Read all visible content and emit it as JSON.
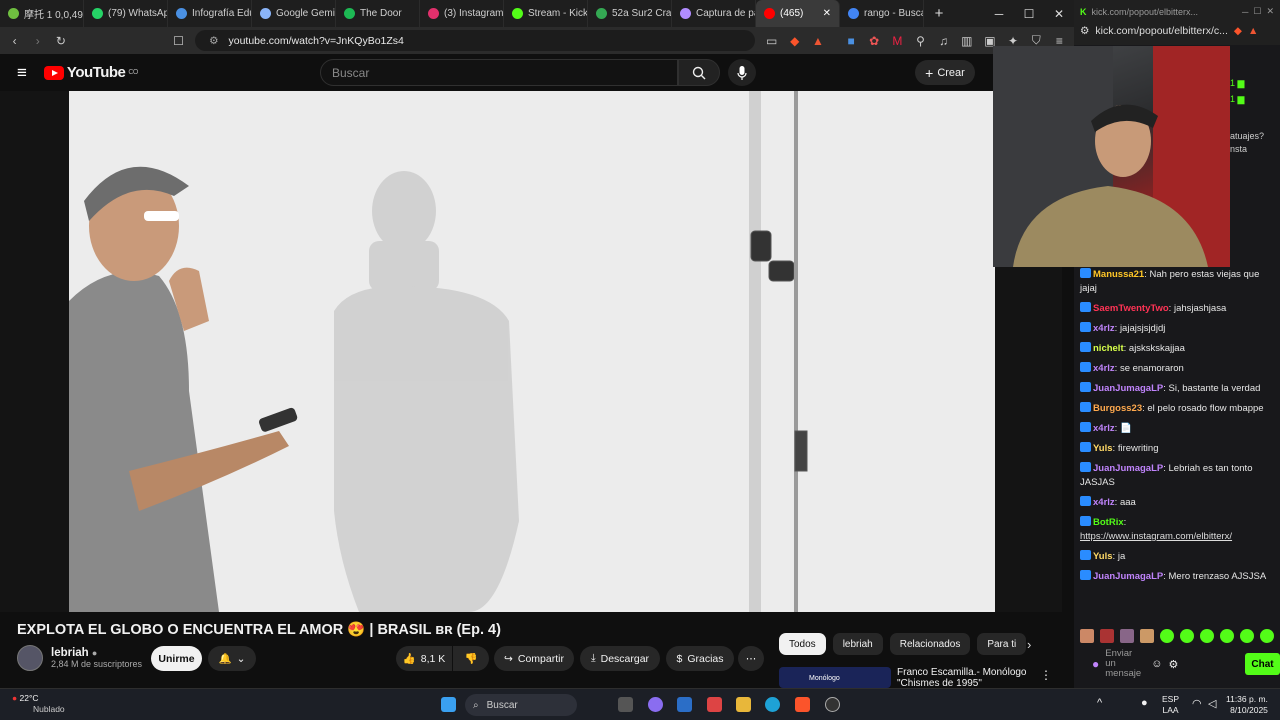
{
  "browser": {
    "tabs": [
      {
        "label": "摩托 1 0,0,494",
        "color": "#6fbf40"
      },
      {
        "label": "(79) WhatsApp",
        "color": "#25d366"
      },
      {
        "label": "Infografía Edu",
        "color": "#4a90e2"
      },
      {
        "label": "Google Gemin",
        "color": "#8ab4f8"
      },
      {
        "label": "The Door",
        "color": "#1db954"
      },
      {
        "label": "(3) Instagram",
        "color": "#e1306c"
      },
      {
        "label": "Stream - Kick",
        "color": "#53fc18"
      },
      {
        "label": "52a Sur2 Cra",
        "color": "#34a853"
      },
      {
        "label": "Captura de pa",
        "color": "#b18cff"
      },
      {
        "label": "(465)",
        "color": "#ff0000",
        "active": true
      },
      {
        "label": "rango - Busca",
        "color": "#4285f4"
      }
    ],
    "new_tab": "+",
    "url": "youtube.com/watch?v=JnKQyBo1Zs4"
  },
  "youtube": {
    "logo_text": "YouTube",
    "country": "CO",
    "search_placeholder": "Buscar",
    "create_label": "Crear",
    "video_title": "EXPLOTA EL GLOBO O ENCUENTRA EL AMOR 😍 | BRASIL ʙʀ (Ep. 4)",
    "channel_name": "lebriah",
    "subscribers": "2,84 M de suscriptores",
    "join_label": "Unirme",
    "likes": "8,1 K",
    "share_label": "Compartir",
    "download_label": "Descargar",
    "thanks_label": "Gracias",
    "more_label": "⋯",
    "chips": [
      "Todos",
      "lebriah",
      "Relacionados",
      "Para ti"
    ],
    "rec_title": "Franco Escamilla.- Monólogo",
    "rec_subtitle": "\"Chismes de 1995\"",
    "rec_thumb_text": "Monólogo"
  },
  "kick": {
    "url_dim": "kick.com/popout/elbitterx...",
    "url": "kick.com/popout/elbitterx/c...",
    "side_text_1": "atuajes?",
    "side_text_2": "nsta",
    "messages": [
      {
        "user": "Manussa21",
        "color": "#ffc627",
        "text": "Nah pero estas viejas que jajaj"
      },
      {
        "user": "SaemTwentyTwo",
        "color": "#ff3355",
        "text": "jahsjashjasa"
      },
      {
        "user": "x4rlz",
        "color": "#c084fc",
        "text": "jajajsjsjdjdj"
      },
      {
        "user": "nichelt",
        "color": "#d7ff4a",
        "text": "ajskskskajjaa"
      },
      {
        "user": "x4rlz",
        "color": "#c084fc",
        "text": "se enamoraron"
      },
      {
        "user": "JuanJumagaLP",
        "color": "#c084fc",
        "text": "Si, bastante la verdad"
      },
      {
        "user": "Burgoss23",
        "color": "#ffa94d",
        "text": "el pelo rosado flow mbappe"
      },
      {
        "user": "x4rlz",
        "color": "#c084fc",
        "text": "📄"
      },
      {
        "user": "Yuls",
        "color": "#ffd966",
        "text": "firewriting"
      },
      {
        "user": "JuanJumagaLP",
        "color": "#c084fc",
        "text": "Lebriah es tan tonto JASJAS"
      },
      {
        "user": "x4rlz",
        "color": "#c084fc",
        "text": "aaa"
      },
      {
        "user": "BotRix",
        "color": "#53fc18",
        "text": "https://www.instagram.com/elbitterx/"
      },
      {
        "user": "Yuls",
        "color": "#ffd966",
        "text": "ja"
      },
      {
        "user": "JuanJumagaLP",
        "color": "#c084fc",
        "text": "Mero trenzaso AJSJSA"
      }
    ],
    "input_placeholder": "Enviar un mensaje",
    "chat_button": "Chat"
  },
  "taskbar": {
    "weather_temp": "22°C",
    "weather_desc": "Nublado",
    "search_label": "Buscar",
    "lang_1": "ESP",
    "lang_2": "LAA",
    "time": "11:36 p. m.",
    "date": "8/10/2025"
  }
}
